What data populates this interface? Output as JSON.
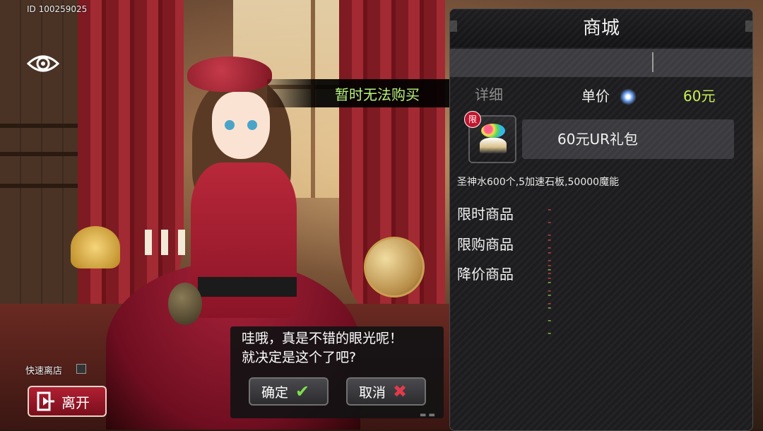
{
  "hud": {
    "player_id": "ID 100259025",
    "view_icon": "eye-icon"
  },
  "toast": {
    "message": "暂时无法购买"
  },
  "shop": {
    "title": "商城",
    "detail_tab": "详细",
    "price_label": "单价",
    "price_value": "60元",
    "price_color": "#c8ef54",
    "item": {
      "badge": "限",
      "name": "60元UR礼包",
      "icon": "gift-box-icon"
    },
    "description": "圣神水600个,5加速石板,50000魔能",
    "features": [
      {
        "label": "限时商品",
        "status": "--- ---",
        "color": "#e04a4a"
      },
      {
        "label": "限购商品",
        "status": "--- ---",
        "color": "#e04a4a"
      },
      {
        "label": "降价商品",
        "status": "--- ---",
        "color": "#9adf3a"
      }
    ]
  },
  "dialog": {
    "text": "哇哦，真是不错的眼光呢！\n就决定是这个了吧?",
    "confirm_label": "确定",
    "confirm_icon": "check-icon",
    "cancel_label": "取消",
    "cancel_icon": "x-icon"
  },
  "footer": {
    "quick_leave_label": "快速离店",
    "leave_label": "离开",
    "leave_icon": "door-exit-icon"
  },
  "colors": {
    "accent_green": "#b8f57e",
    "leave_button": "#b02032",
    "panel_bg": "#1c1c1e"
  }
}
